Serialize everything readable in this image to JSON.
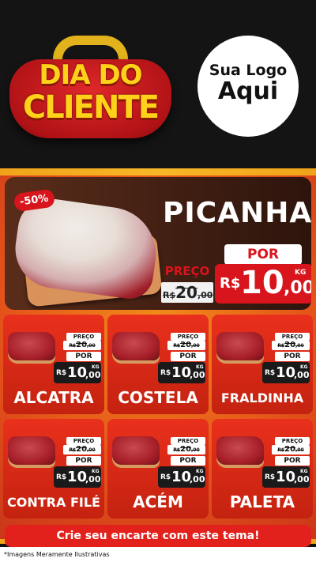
{
  "header": {
    "badge_line1": "DIA DO",
    "badge_line2": "CLIENTE",
    "logo_line1": "Sua Logo",
    "logo_line2": "Aqui"
  },
  "hero": {
    "discount": "-50%",
    "name": "PICANHA",
    "preco_label": "PREÇO",
    "old_currency": "R$",
    "old_int": "20",
    "old_dec": ",00",
    "por_label": "POR",
    "currency": "R$",
    "price_int": "10",
    "price_dec": ",00",
    "unit": "KG"
  },
  "cards": [
    {
      "name": "ALCATRA"
    },
    {
      "name": "COSTELA"
    },
    {
      "name": "FRALDINHA"
    },
    {
      "name": "CONTRA FILÉ"
    },
    {
      "name": "ACÉM"
    },
    {
      "name": "PALETA"
    }
  ],
  "card_price": {
    "preco_label": "PREÇO",
    "old_currency": "R$",
    "old_int": "20",
    "old_dec": ",00",
    "por_label": "POR",
    "currency": "R$",
    "price_int": "10",
    "price_dec": ",00",
    "unit": "KG"
  },
  "cta": "Crie seu encarte com este tema!",
  "footnote": "*Imagens Meramente Ilustrativas",
  "colors": {
    "background": "#141414",
    "accent_red": "#d8141c",
    "accent_yellow": "#f7b826",
    "card_red": "#e9301c"
  }
}
